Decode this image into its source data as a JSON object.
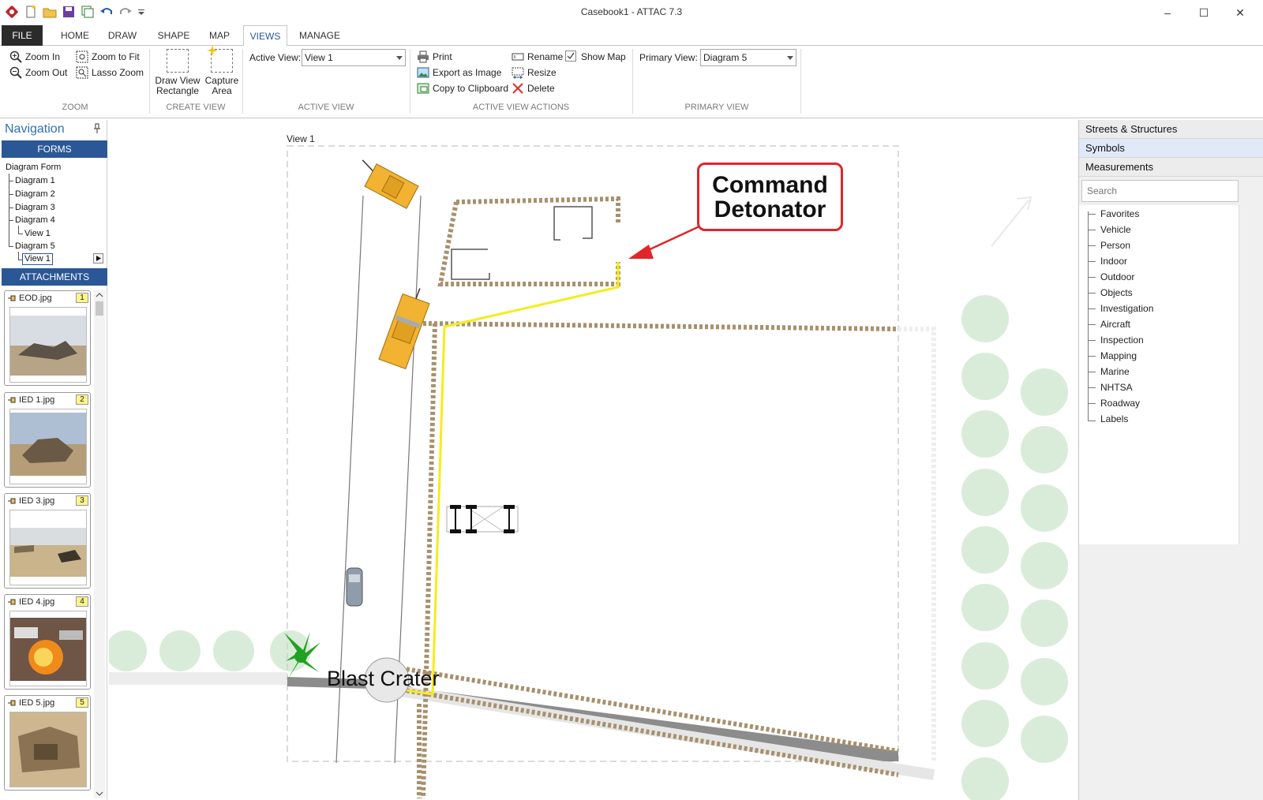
{
  "window": {
    "title": "Casebook1 - ATTAC 7.3"
  },
  "tabs": [
    "FILE",
    "HOME",
    "DRAW",
    "SHAPE",
    "MAP",
    "VIEWS",
    "MANAGE"
  ],
  "ribbon": {
    "zoom": {
      "zoom_in": "Zoom In",
      "zoom_out": "Zoom Out",
      "zoom_fit": "Zoom to Fit",
      "lasso": "Lasso Zoom",
      "label": "ZOOM"
    },
    "create_view": {
      "draw_rect_1": "Draw View",
      "draw_rect_2": "Rectangle",
      "capture_1": "Capture",
      "capture_2": "Area",
      "label": "CREATE VIEW"
    },
    "active_view": {
      "caption": "Active View:",
      "value": "View 1",
      "label": "ACTIVE VIEW"
    },
    "actions": {
      "print": "Print",
      "export": "Export as Image",
      "copy": "Copy to Clipboard",
      "rename": "Rename",
      "resize": "Resize",
      "delete": "Delete",
      "show_map": "Show Map",
      "label": "ACTIVE VIEW ACTIONS"
    },
    "primary_view": {
      "caption": "Primary View:",
      "value": "Diagram 5",
      "label": "PRIMARY VIEW"
    }
  },
  "navigation": {
    "title": "Navigation",
    "forms_header": "FORMS",
    "tree": [
      "Diagram Form",
      "Diagram 1",
      "Diagram 2",
      "Diagram 3",
      "Diagram 4",
      "View 1",
      "Diagram 5",
      "View 1"
    ],
    "attachments_header": "ATTACHMENTS",
    "attachments": [
      {
        "name": "EOD.jpg",
        "num": "1"
      },
      {
        "name": "IED 1.jpg",
        "num": "2"
      },
      {
        "name": "IED 3.jpg",
        "num": "3"
      },
      {
        "name": "IED 4.jpg",
        "num": "4"
      },
      {
        "name": "IED 5.jpg",
        "num": "5"
      }
    ]
  },
  "canvas": {
    "view_label": "View 1",
    "callout_line1": "Command",
    "callout_line2": "Detonator",
    "crater_label": "Blast Crater"
  },
  "right_panel": {
    "headers": [
      "Streets & Structures",
      "Symbols",
      "Measurements"
    ],
    "search_placeholder": "Search",
    "items": [
      "Favorites",
      "Vehicle",
      "Person",
      "Indoor",
      "Outdoor",
      "Objects",
      "Investigation",
      "Aircraft",
      "Inspection",
      "Mapping",
      "Marine",
      "NHTSA",
      "Roadway",
      "Labels"
    ]
  },
  "colors": {
    "accent": "#2b5797",
    "callout": "#e0252b",
    "wire": "#f5ec1c",
    "vehicle": "#f2b232",
    "wall": "#a8906d"
  }
}
